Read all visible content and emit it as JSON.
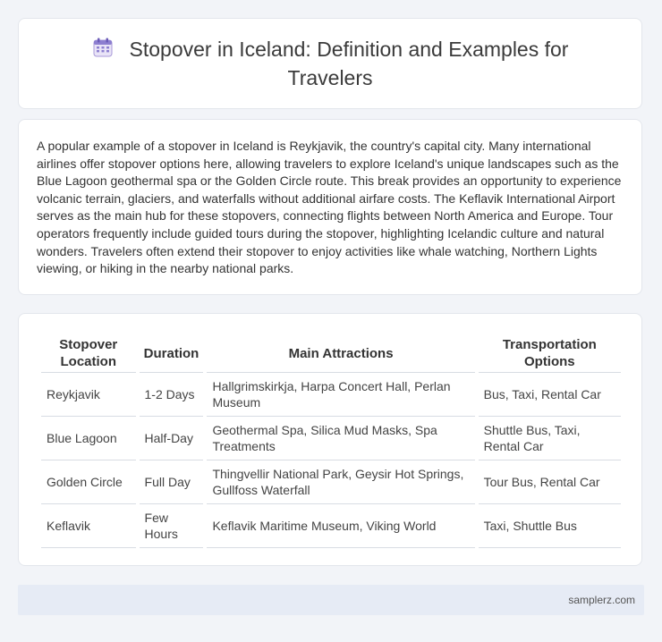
{
  "header": {
    "title": "Stopover in Iceland: Definition and Examples for Travelers",
    "icon": "calendar-icon"
  },
  "intro": {
    "text": "A popular example of a stopover in Iceland is Reykjavik, the country's capital city. Many international airlines offer stopover options here, allowing travelers to explore Iceland's unique landscapes such as the Blue Lagoon geothermal spa or the Golden Circle route. This break provides an opportunity to experience volcanic terrain, glaciers, and waterfalls without additional airfare costs. The Keflavik International Airport serves as the main hub for these stopovers, connecting flights between North America and Europe. Tour operators frequently include guided tours during the stopover, highlighting Icelandic culture and natural wonders. Travelers often extend their stopover to enjoy activities like whale watching, Northern Lights viewing, or hiking in the nearby national parks."
  },
  "table": {
    "headers": [
      "Stopover Location",
      "Duration",
      "Main Attractions",
      "Transportation Options"
    ],
    "rows": [
      [
        "Reykjavik",
        "1-2 Days",
        "Hallgrimskirkja, Harpa Concert Hall, Perlan Museum",
        "Bus, Taxi, Rental Car"
      ],
      [
        "Blue Lagoon",
        "Half-Day",
        "Geothermal Spa, Silica Mud Masks, Spa Treatments",
        "Shuttle Bus, Taxi, Rental Car"
      ],
      [
        "Golden Circle",
        "Full Day",
        "Thingvellir National Park, Geysir Hot Springs, Gullfoss Waterfall",
        "Tour Bus, Rental Car"
      ],
      [
        "Keflavik",
        "Few Hours",
        "Keflavik Maritime Museum, Viking World",
        "Taxi, Shuttle Bus"
      ]
    ]
  },
  "footer": {
    "brand": "samplerz.com"
  }
}
